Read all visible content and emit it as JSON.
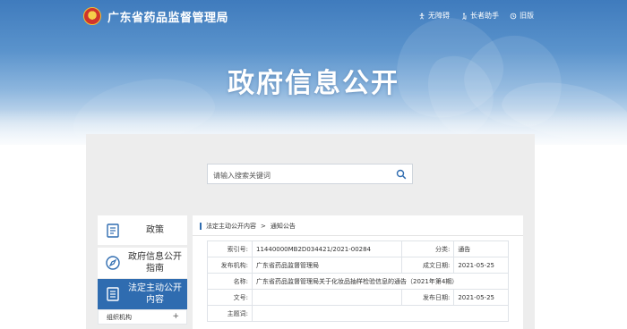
{
  "header": {
    "site_name": "广东省药品监督管理局",
    "links": [
      {
        "label": "无障碍",
        "icon": "accessibility-icon"
      },
      {
        "label": "长者助手",
        "icon": "elder-assist-icon"
      },
      {
        "label": "旧版",
        "icon": "old-version-icon"
      }
    ]
  },
  "banner": {
    "title": "政府信息公开"
  },
  "search": {
    "placeholder": "请输入搜索关键词"
  },
  "nav": {
    "items": [
      {
        "label": "政策",
        "icon": "book-icon",
        "active": false
      },
      {
        "label": "政府信息公开指南",
        "icon": "compass-icon",
        "active": false
      },
      {
        "label": "法定主动公开内容",
        "icon": "document-icon",
        "active": true
      }
    ],
    "sub_item": {
      "label": "组织机构",
      "toggle": "+"
    }
  },
  "breadcrumb": {
    "first": "法定主动公开内容",
    "separator": ">",
    "second": "通知公告"
  },
  "meta": {
    "index_label": "索引号:",
    "index_value": "11440000MB2D034421/2021-00284",
    "category_label": "分类:",
    "category_value": "通告",
    "publisher_label": "发布机构:",
    "publisher_value": "广东省药品监督管理局",
    "created_label": "成文日期:",
    "created_value": "2021-05-25",
    "name_label": "名称:",
    "name_value": "广东省药品监督管理局关于化妆品抽样检验信息的通告（2021年第4期）",
    "docno_label": "文号:",
    "docno_value": "",
    "pubdate_label": "发布日期:",
    "pubdate_value": "2021-05-25",
    "subject_label": "主题词:",
    "subject_value": ""
  },
  "colors": {
    "accent": "#2f6cb0",
    "banner_top": "#3f7bbd",
    "panel_bg": "#ededed"
  }
}
